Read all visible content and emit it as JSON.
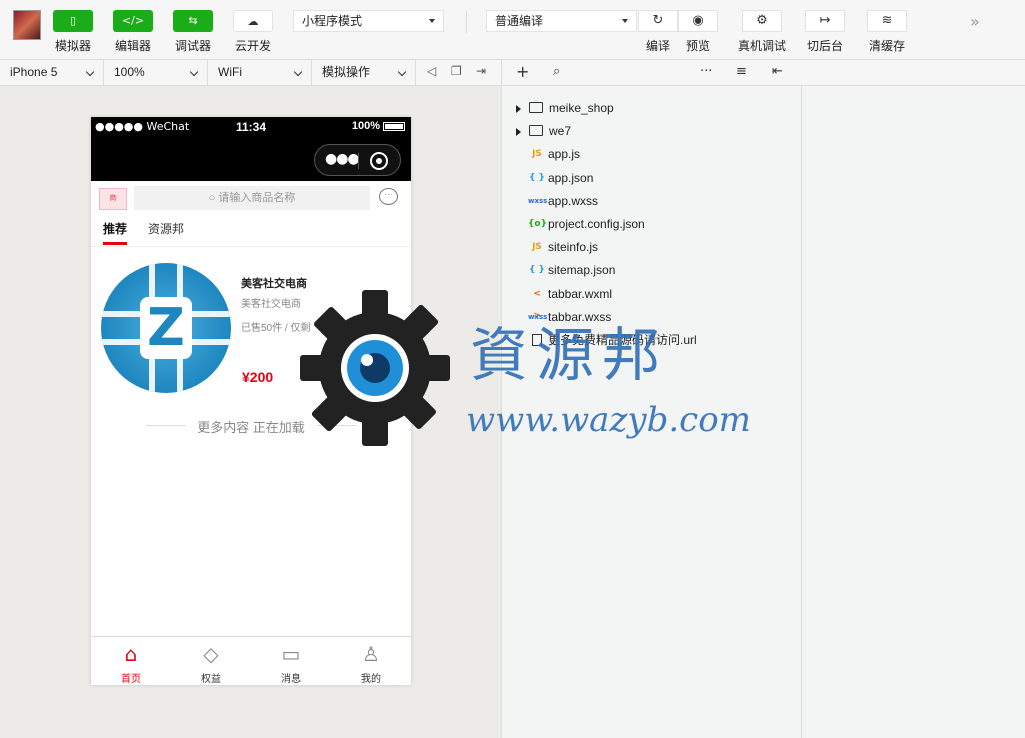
{
  "toolbar": {
    "buttons": [
      {
        "label": "模拟器",
        "icon": "▯"
      },
      {
        "label": "编辑器",
        "icon": "</>"
      },
      {
        "label": "调试器",
        "icon": "⇆"
      },
      {
        "label": "云开发",
        "icon": "☁"
      }
    ],
    "mode_select": "小程序模式",
    "compile_select": "普通编译",
    "right_buttons": [
      {
        "label": "编译",
        "icon": "↻"
      },
      {
        "label": "预览",
        "icon": "◉"
      },
      {
        "label": "真机调试",
        "icon": "⚙"
      },
      {
        "label": "切后台",
        "icon": "↦"
      },
      {
        "label": "清缓存",
        "icon": "≋"
      }
    ],
    "more_icon": "»"
  },
  "simulator_bar": {
    "device": "iPhone 5",
    "zoom": "100%",
    "network": "WiFi",
    "operation": "模拟操作"
  },
  "phone": {
    "status": {
      "signal": "●●●●● WeChat",
      "time": "11:34",
      "battery": "100%"
    },
    "search_placeholder": "请输入商品名称",
    "shop_logo_text": "商",
    "tabs": [
      "推荐",
      "资源邦"
    ],
    "product": {
      "name": "美客社交电商",
      "subtitle": "美客社交电商",
      "sold": "已售50件 / 仅剩",
      "price": "¥200"
    },
    "loading_text": "更多内容 正在加载",
    "tabbar": [
      {
        "label": "首页",
        "icon": "⌂"
      },
      {
        "label": "权益",
        "icon": "◇"
      },
      {
        "label": "消息",
        "icon": "▭"
      },
      {
        "label": "我的",
        "icon": "♙"
      }
    ]
  },
  "watermark": {
    "cn": "資源邦",
    "url": "www.wazyb.com"
  },
  "files": [
    {
      "name": "meike_shop",
      "type": "folder"
    },
    {
      "name": "we7",
      "type": "folder"
    },
    {
      "name": "app.js",
      "type": "js",
      "badge": "JS",
      "color": "#e5a50a"
    },
    {
      "name": "app.json",
      "type": "json",
      "badge": "{ }",
      "color": "#2a9fd6"
    },
    {
      "name": "app.wxss",
      "type": "wxss",
      "badge": "wxss",
      "color": "#2a6fd6"
    },
    {
      "name": "project.config.json",
      "type": "config",
      "badge": "{o}",
      "color": "#1aad19"
    },
    {
      "name": "siteinfo.js",
      "type": "js",
      "badge": "JS",
      "color": "#e5a50a"
    },
    {
      "name": "sitemap.json",
      "type": "json",
      "badge": "{ }",
      "color": "#2a9fd6"
    },
    {
      "name": "tabbar.wxml",
      "type": "wxml",
      "badge": "< >",
      "color": "#e0601a"
    },
    {
      "name": "tabbar.wxss",
      "type": "wxss",
      "badge": "wxss",
      "color": "#2a6fd6"
    },
    {
      "name": "更多免费精品源码请访问.url",
      "type": "file",
      "badge": "",
      "color": "#333"
    }
  ]
}
